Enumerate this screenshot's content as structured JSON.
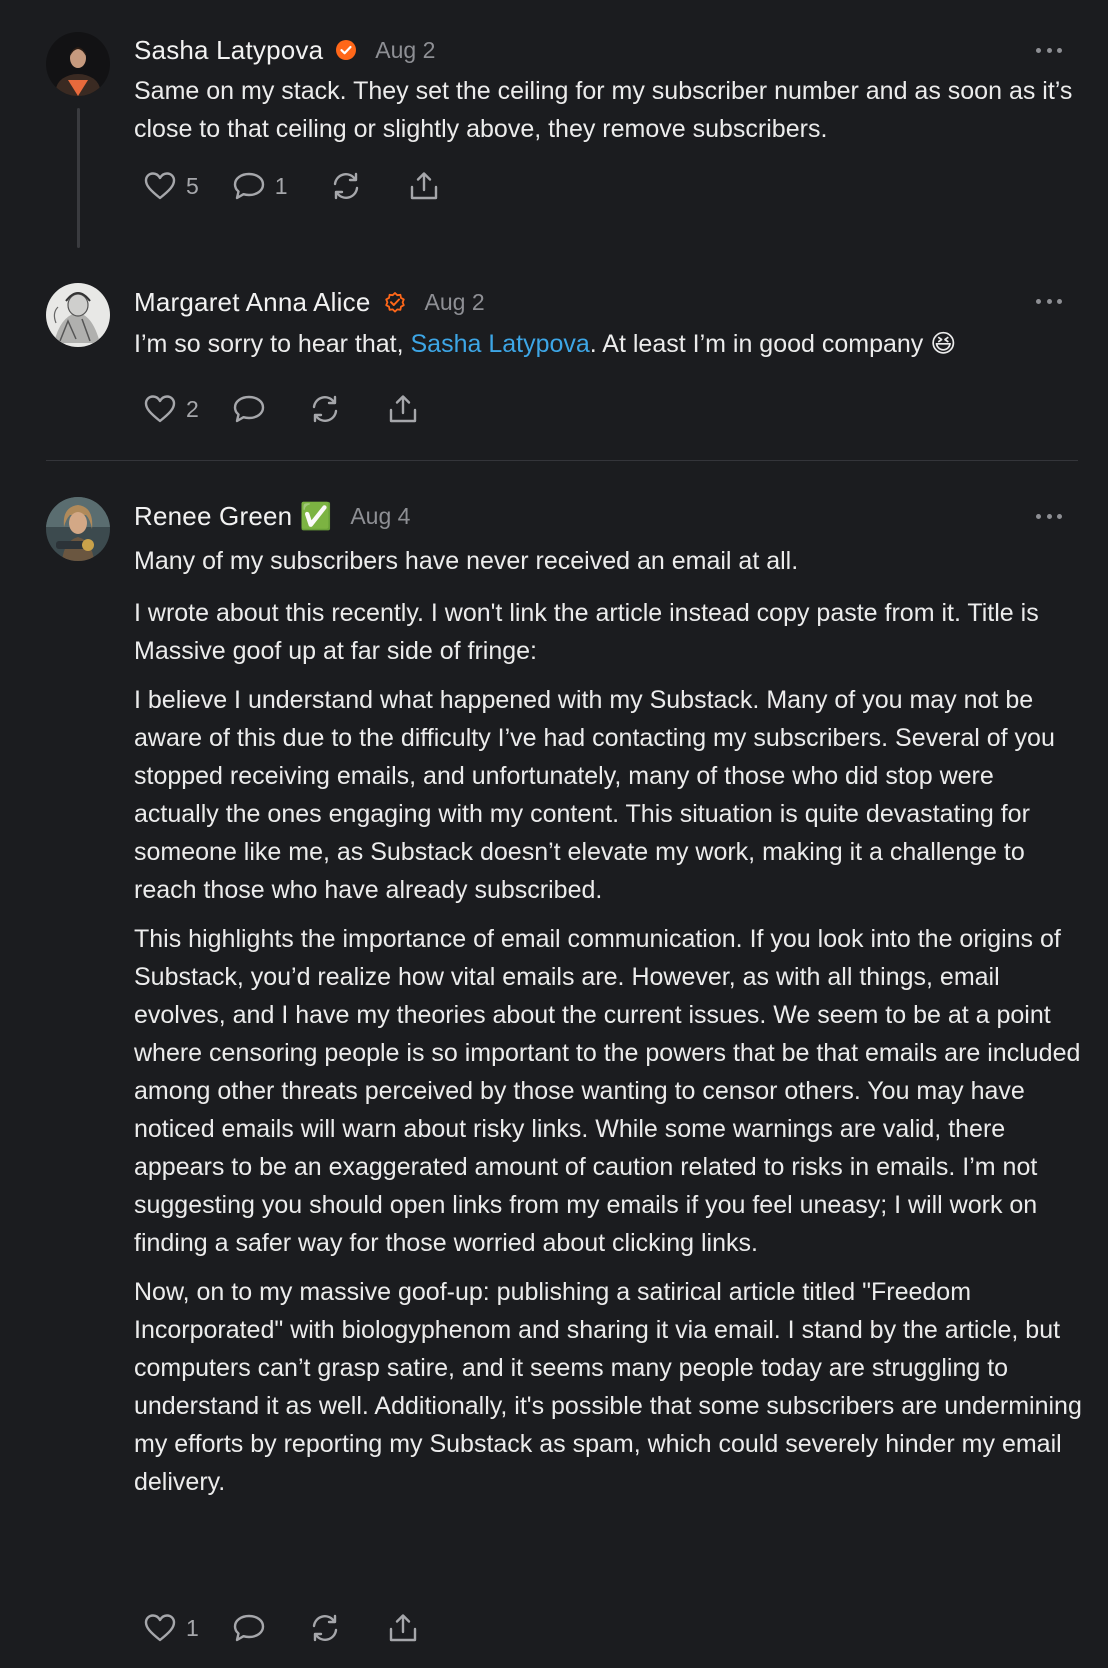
{
  "comments": [
    {
      "author": "Sasha Latypova",
      "badge": "paid-subscriber-badge",
      "badge_color": "#ff6719",
      "date": "Aug 2",
      "body_paragraphs": [
        "Same on my stack. They set the ceiling for my subscriber number and as soon as it’s close to that ceiling or slightly above, they remove subscribers."
      ],
      "likes": "5",
      "replies": "1"
    },
    {
      "author": "Margaret Anna Alice",
      "badge": "subscriber-badge-outline",
      "badge_color": "#ff6719",
      "date": "Aug 2",
      "body_before": "I’m so sorry to hear that, ",
      "mention": "Sasha Latypova",
      "body_after": ". At least I’m in good company 😆",
      "likes": "2",
      "replies": ""
    },
    {
      "author": "Renee Green ✅",
      "date": "Aug 4",
      "body_paragraphs": [
        "Many of my subscribers have never received an email at all.",
        "I wrote about this recently. I won't link the article instead copy paste from it. Title is Massive goof up at far side of fringe:",
        "I believe I understand what happened with my Substack. Many of you may not be aware of this due to the difficulty I’ve had contacting my subscribers. Several of you stopped receiving emails, and unfortunately, many of those who did stop were actually the ones engaging with my content. This situation is quite devastating for someone like me, as Substack doesn’t elevate my work, making it a challenge to reach those who have already subscribed.",
        "This highlights the importance of email communication. If you look into the origins of Substack, you’d realize how vital emails are. However, as with all things, email evolves, and I have my theories about the current issues. We seem to be at a point where censoring people is so important to the powers that be that emails are included among other threats perceived by those wanting to censor others. You may have noticed emails will warn about risky links. While some warnings are valid, there appears to be an exaggerated amount of caution related to risks in emails. I’m not suggesting you should open links from my emails if you feel uneasy; I will work on finding a safer way for those worried about clicking links.",
        "Now, on to my massive goof-up: publishing a satirical article titled \"Freedom Incorporated\" with biologyphenom and sharing it via email. I stand by the article, but computers can’t grasp satire, and it seems many people today are struggling to understand it as well. Additionally, it's possible that some subscribers are undermining my efforts by reporting my Substack as spam, which could severely hinder my email delivery."
      ],
      "likes": "1",
      "replies": ""
    }
  ],
  "colors": {
    "background": "#1b1c1f",
    "text": "#ececec",
    "muted": "#8e8f94",
    "mention": "#3da6e6",
    "accent": "#ff6719"
  }
}
